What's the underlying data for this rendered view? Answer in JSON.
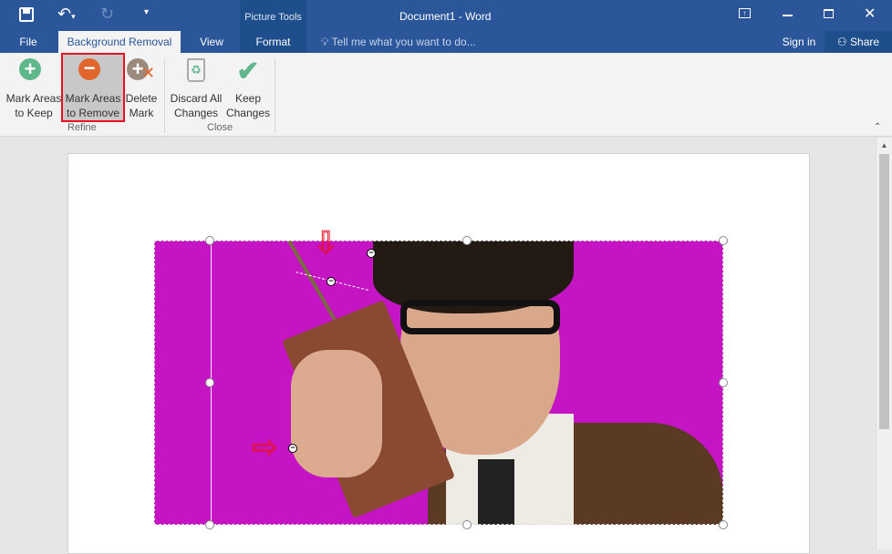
{
  "title": "Document1 - Word",
  "contextual_group": "Picture Tools",
  "tabs": {
    "file": "File",
    "background_removal": "Background Removal",
    "view": "View",
    "format": "Format"
  },
  "tell_me": "Tell me what you want to do...",
  "sign_in": "Sign in",
  "share": "Share",
  "ribbon": {
    "mark_keep_1": "Mark Areas",
    "mark_keep_2": "to Keep",
    "mark_remove_1": "Mark Areas",
    "mark_remove_2": "to Remove",
    "delete_1": "Delete",
    "delete_2": "Mark",
    "discard_1": "Discard All",
    "discard_2": "Changes",
    "keep_1": "Keep",
    "keep_2": "Changes",
    "group_refine": "Refine",
    "group_close": "Close"
  },
  "colors": {
    "brand": "#2b579a",
    "removal_area": "#c414c4",
    "highlight": "#e81123"
  }
}
